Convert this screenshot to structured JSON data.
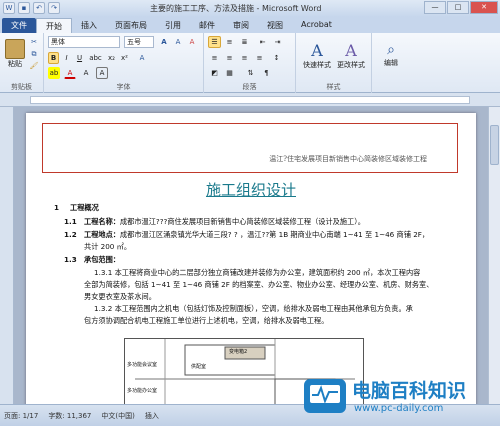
{
  "window": {
    "title": "主要的施工工序、方法及措施 - Microsoft Word"
  },
  "tabs": [
    "文件",
    "开始",
    "插入",
    "页面布局",
    "引用",
    "邮件",
    "审阅",
    "视图",
    "Acrobat"
  ],
  "ribbon": {
    "clipboard": {
      "label": "剪贴板",
      "paste": "粘贴"
    },
    "font": {
      "label": "字体",
      "name": "黑体",
      "size": "五号"
    },
    "paragraph": {
      "label": "段落"
    },
    "styles": {
      "label": "样式",
      "quick": "快速样式",
      "change": "更改样式"
    },
    "edit": {
      "label": "",
      "edit": "编辑"
    }
  },
  "document": {
    "header": "温江?住宅发展项目新销售中心简装修区域装修工程",
    "title": "施工组织设计",
    "lines": [
      {
        "num": "1",
        "text": "工程概况"
      },
      {
        "num": "1.1",
        "label": "工程名称：",
        "text": "成都市温江???商住发展项目新销售中心简装修区域装修工程（设计及施工）。"
      },
      {
        "num": "1.2",
        "label": "工程地点：",
        "text": "成都市温江区涌泉镇光华大道三段? ? ，温江??第 1B 期商业中心南端 1~41 至 1~46 商铺 2F，"
      },
      {
        "num": "",
        "text": "共计 200 ㎡。"
      },
      {
        "num": "1.3",
        "label": "承包范围：",
        "text": ""
      },
      {
        "num": "",
        "text": "1.3.1  本工程将商业中心的二层部分独立商铺改建并装修为办公室，建筑面积约 200 ㎡，本次工程内容"
      },
      {
        "num": "",
        "text": "全部为简装修，包括 1~41 至 1~46 商铺 2F 的档案室、办公室、物业办公室、经理办公室、机房、财务室、"
      },
      {
        "num": "",
        "text": "男女更衣室及茶水间。"
      },
      {
        "num": "",
        "text": "1.3.2  本工程范围内之机电（包括灯饰及控制面板），空调，给排水及弱电工程由其他承包方负责。承"
      },
      {
        "num": "",
        "text": "包方须协调配合机电工程施工单位进行上述机电，空调，给排水及弱电工程。"
      }
    ],
    "plan_labels": [
      "多功能会议室",
      "变电箱2",
      "供配室",
      "多功能办公室"
    ]
  },
  "status": {
    "page": "页面: 1/17",
    "words": "字数: 11,367",
    "lang": "中文(中国)",
    "mode": "插入"
  },
  "watermark": {
    "title": "电脑百科知识",
    "url": "www.pc-daily.com"
  }
}
